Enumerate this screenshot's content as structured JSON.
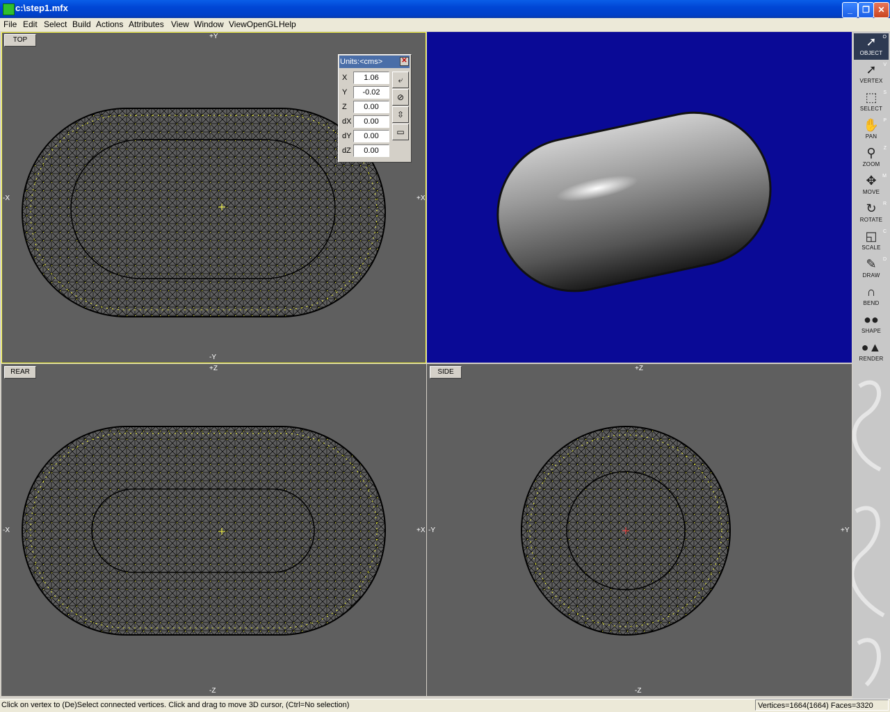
{
  "window": {
    "title": "c:\\step1.mfx"
  },
  "menu": [
    "File",
    "Edit",
    "Select",
    "Build",
    "Actions",
    "Attributes",
    "View",
    "Window",
    "ViewOpenGL",
    "Help"
  ],
  "viewports": {
    "top": {
      "label": "TOP",
      "axis_top": "+Y",
      "axis_bottom": "-Y",
      "axis_left": "-X",
      "axis_right": "+X"
    },
    "rear": {
      "label": "REAR",
      "axis_top": "+Z",
      "axis_bottom": "-Z",
      "axis_left": "-X",
      "axis_right": "+X"
    },
    "side": {
      "label": "SIDE",
      "axis_top": "+Z",
      "axis_bottom": "-Z",
      "axis_left": "-Y",
      "axis_right": "+Y"
    }
  },
  "units_panel": {
    "title": "Units:<cms>",
    "fields": [
      {
        "label": "X",
        "value": "1.06"
      },
      {
        "label": "Y",
        "value": "-0.02"
      },
      {
        "label": "Z",
        "value": "0.00"
      },
      {
        "label": "dX",
        "value": "0.00"
      },
      {
        "label": "dY",
        "value": "0.00"
      },
      {
        "label": "dZ",
        "value": "0.00"
      }
    ]
  },
  "tools": [
    {
      "label": "OBJECT",
      "key": "O",
      "icon": "cursor-icon",
      "active": true
    },
    {
      "label": "VERTEX",
      "key": "V",
      "icon": "cursor-icon"
    },
    {
      "label": "SELECT",
      "key": "S",
      "icon": "marquee-icon"
    },
    {
      "label": "PAN",
      "key": "P",
      "icon": "hand-icon"
    },
    {
      "label": "ZOOM",
      "key": "Z",
      "icon": "magnifier-icon"
    },
    {
      "label": "MOVE",
      "key": "M",
      "icon": "move-arrows-icon"
    },
    {
      "label": "ROTATE",
      "key": "R",
      "icon": "rotate-icon"
    },
    {
      "label": "SCALE",
      "key": "C",
      "icon": "scale-icon"
    },
    {
      "label": "DRAW",
      "key": "D",
      "icon": "pen-icon"
    },
    {
      "label": "BEND",
      "key": "",
      "icon": "magnet-icon"
    },
    {
      "label": "SHAPE",
      "key": "",
      "icon": "spheres-icon"
    },
    {
      "label": "RENDER",
      "key": "",
      "icon": "sphere-cone-icon"
    }
  ],
  "status": {
    "message": "Click on vertex to (De)Select connected vertices. Click and drag to move 3D cursor, (Ctrl=No selection)",
    "counts": "Vertices=1664(1664) Faces=3320"
  },
  "colors": {
    "viewport_bg": "#5f5f5f",
    "opengl_bg": "#0a0a96",
    "vertex": "#ffff40",
    "active_border": "#ffff40"
  }
}
